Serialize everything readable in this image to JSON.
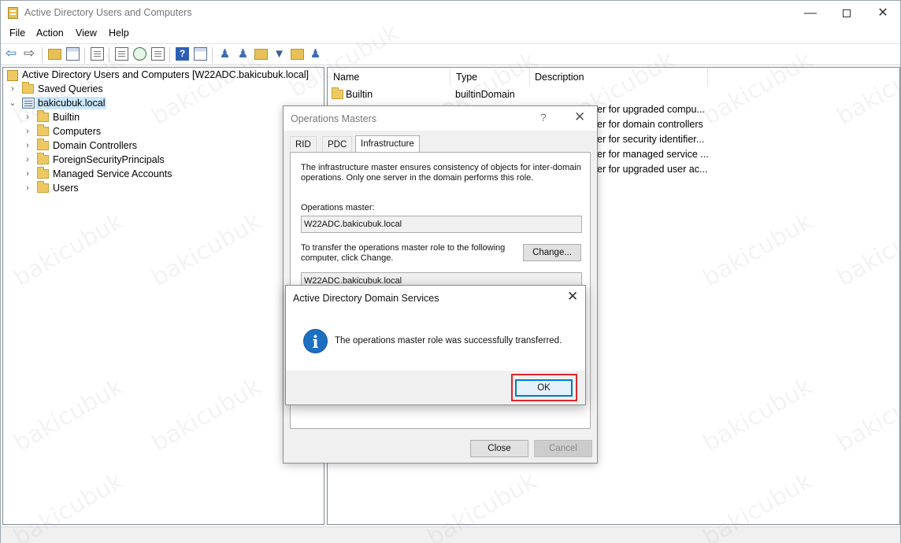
{
  "window": {
    "title": "Active Directory Users and Computers",
    "controls": {
      "minimize": "—",
      "maximize": "",
      "close": "✕"
    }
  },
  "menu": [
    "File",
    "Action",
    "View",
    "Help"
  ],
  "toolbar": {
    "icons": [
      "back-arrow-icon",
      "forward-arrow-icon",
      "up-folder-icon",
      "show-hide-tree-icon",
      "clipboard-icon",
      "properties-icon",
      "refresh-icon",
      "export-list-icon",
      "help-icon",
      "details-view-icon",
      "new-user-icon",
      "new-group-icon",
      "new-ou-icon",
      "filter-icon",
      "add-to-group-icon",
      "find-icon"
    ]
  },
  "tree": {
    "root": "Active Directory Users and Computers [W22ADC.bakicubuk.local]",
    "saved_queries": "Saved Queries",
    "domain": "bakicubuk.local",
    "children": [
      "Builtin",
      "Computers",
      "Domain Controllers",
      "ForeignSecurityPrincipals",
      "Managed Service Accounts",
      "Users"
    ]
  },
  "list": {
    "columns": [
      "Name",
      "Type",
      "Description"
    ],
    "rows": [
      {
        "name": "Builtin",
        "type": "builtinDomain",
        "description": ""
      },
      {
        "name": "",
        "type": "",
        "description": "er for upgraded compu..."
      },
      {
        "name": "",
        "type": "",
        "description": "er for domain controllers"
      },
      {
        "name": "",
        "type": "",
        "description": "er for security identifier..."
      },
      {
        "name": "",
        "type": "",
        "description": "er for managed service ..."
      },
      {
        "name": "",
        "type": "",
        "description": "er for upgraded user ac..."
      }
    ]
  },
  "ops_dialog": {
    "title": "Operations Masters",
    "help": "?",
    "close": "✕",
    "tabs": [
      "RID",
      "PDC",
      "Infrastructure"
    ],
    "active_tab": "Infrastructure",
    "description": "The infrastructure master ensures consistency of objects for inter-domain operations. Only one server in the domain performs this role.",
    "master_label": "Operations master:",
    "master_value": "W22ADC.bakicubuk.local",
    "transfer_text": "To transfer the operations master role to the following computer, click Change.",
    "change_button": "Change...",
    "target_value": "W22ADC.bakicubuk.local",
    "close_button": "Close",
    "cancel_button": "Cancel"
  },
  "message_box": {
    "title": "Active Directory Domain Services",
    "close": "✕",
    "icon": "i",
    "message": "The operations master role was successfully transferred.",
    "ok_button": "OK"
  },
  "watermark": "bakicubuk"
}
